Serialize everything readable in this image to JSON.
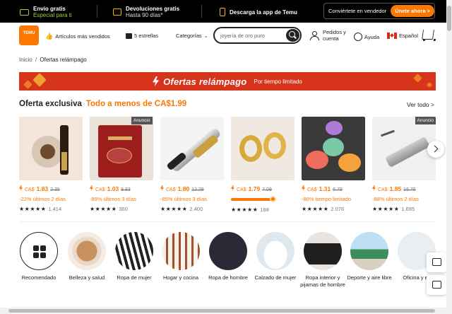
{
  "topbar": {
    "shipping_title": "Envío gratis",
    "shipping_sub": "Especial para ti",
    "returns_title": "Devoluciones gratis",
    "returns_sub": "Hasta 90 días*",
    "app_label": "Descarga la app de Temu",
    "seller_label": "Conviértete en vendedor",
    "seller_cta": "Únete ahora",
    "seller_arrow": ">"
  },
  "header": {
    "logo_text": "TEMU",
    "best_sellers": "Artículos más vendidos",
    "five_stars": "5 estrellas",
    "categories": "Categorías",
    "search_placeholder": "joyería de oro puro",
    "orders": "Pedidos y cuenta",
    "help": "Ayuda",
    "language": "Español"
  },
  "breadcrumb": {
    "home": "Inicio",
    "separator": "/",
    "current": "Ofertas relámpago"
  },
  "banner": {
    "title": "Ofertas relámpago",
    "subtitle": "Por tiempo limitado"
  },
  "section": {
    "title": "Oferta exclusiva",
    "highlight": "Todo a menos de CA$1.99",
    "view_all": "Ver todo",
    "view_all_arrow": ">"
  },
  "products": [
    {
      "currency": "CA$",
      "price": "1.83",
      "old": "2.35",
      "discount": "-22% últimos 2 días",
      "stars": "★★★★★",
      "reviews": "1.414",
      "ad": ""
    },
    {
      "currency": "CA$",
      "price": "1.03",
      "old": "9.83",
      "discount": "-89% últimos 3 días",
      "stars": "★★★★★",
      "reviews": "360",
      "ad": ""
    },
    {
      "currency": "CA$",
      "price": "1.80",
      "old": "12.29",
      "discount": "-85% últimos 3 días",
      "stars": "★★★★★",
      "reviews": "2.400",
      "ad": ""
    },
    {
      "currency": "CA$",
      "price": "1.79",
      "old": "7.09",
      "discount": "",
      "stars": "★★★★★",
      "reviews": "168",
      "ad": "",
      "claimed_fraction": 0.9
    },
    {
      "currency": "CA$",
      "price": "1.31",
      "old": "6.79",
      "discount": "-80% tiempo limitado",
      "stars": "★★★★★",
      "reviews": "2.076",
      "ad": ""
    },
    {
      "currency": "CA$",
      "price": "1.85",
      "old": "16.76",
      "discount": "-88% últimos 2 días",
      "stars": "★★★★★",
      "reviews": "1.695",
      "ad": "Anuncio"
    }
  ],
  "ad_badge": "Anuncio",
  "categories": [
    {
      "label": "Recomendado"
    },
    {
      "label": "Belleza y salud"
    },
    {
      "label": "Ropa de mujer"
    },
    {
      "label": "Hogar y cocina"
    },
    {
      "label": "Ropa de hombre"
    },
    {
      "label": "Calzado de mujer"
    },
    {
      "label": "Ropa interior y pijamas de hombre"
    },
    {
      "label": "Deporte y aire libre"
    },
    {
      "label": "Oficina y es"
    }
  ],
  "icons": {
    "truck": "truck-icon",
    "box": "return-box-icon",
    "phone": "phone-icon",
    "search": "search-icon",
    "user": "user-icon",
    "help": "help-icon",
    "flag": "canada-flag-icon",
    "cart": "cart-icon",
    "chevron": "chevron-right-icon"
  },
  "colors": {
    "accent": "#fb7701",
    "banner": "#d6351b",
    "topbar": "#000000"
  }
}
